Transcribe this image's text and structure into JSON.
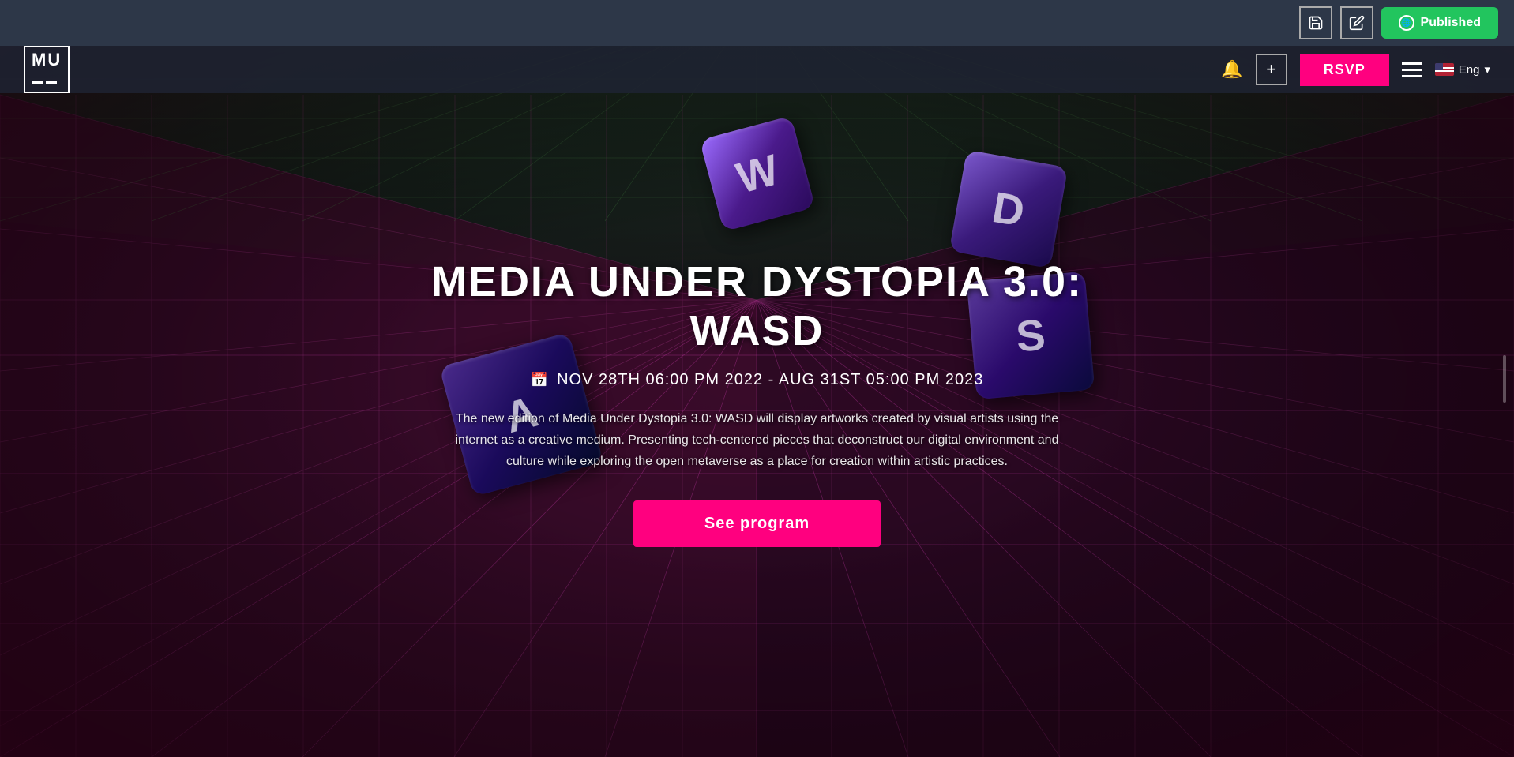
{
  "admin_bar": {
    "save_label": "💾",
    "edit_label": "✎",
    "published_label": "Published"
  },
  "site_nav": {
    "logo": "MU",
    "rsvp_label": "RSVP",
    "lang_label": "Eng"
  },
  "hero": {
    "title": "MEDIA UNDER DYSTOPIA 3.0: WASD",
    "date": "NOV 28TH 06:00 PM 2022 - AUG 31ST 05:00 PM 2023",
    "description": "The new edition of Media Under Dystopia 3.0: WASD will display artworks created by visual artists using the internet as a creative medium. Presenting tech-centered pieces that deconstruct our digital environment and culture while exploring the open metaverse as a place for creation within artistic practices.",
    "cta_label": "See program",
    "keys": [
      "W",
      "D",
      "S",
      "A"
    ]
  }
}
